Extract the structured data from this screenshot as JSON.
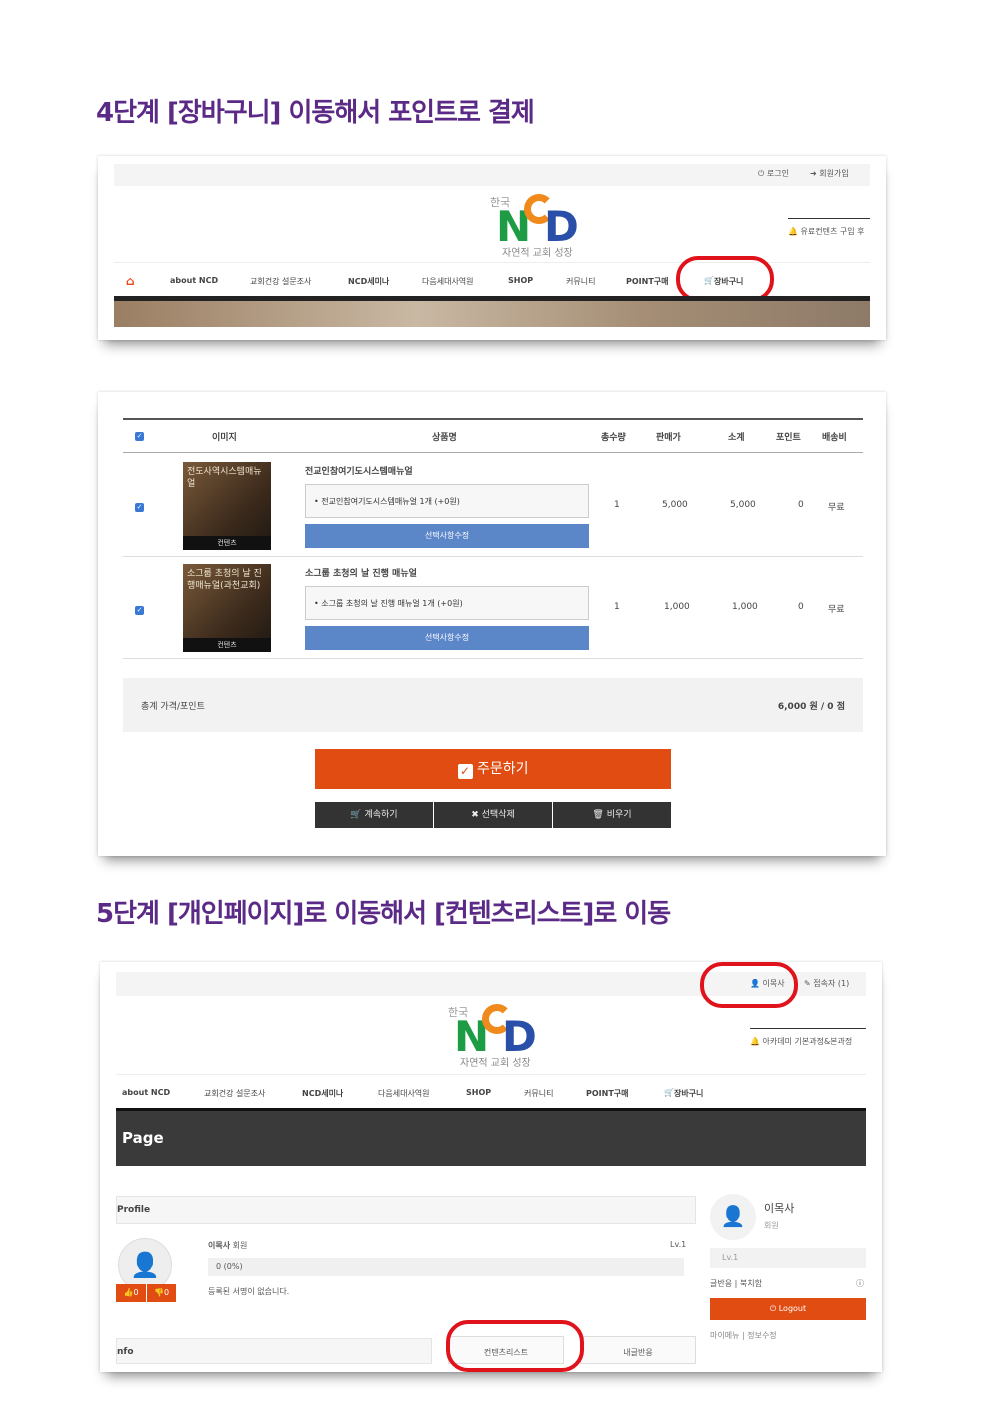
{
  "step4": {
    "title": "4단계 [장바구니] 이동해서 포인트로 결제",
    "topbar": {
      "login": "로그인",
      "join": "회원가입"
    },
    "logo": {
      "kr": "한국",
      "n": "N",
      "d": "D",
      "sub": "자연적 교회 성장"
    },
    "paid_label": "유료컨텐츠 구입 후",
    "nav": [
      "about NCD",
      "교회건강 설문조사",
      "NCD세미나",
      "다음세대사역원",
      "SHOP",
      "커뮤니티",
      "POINT구매",
      "장바구니"
    ]
  },
  "cart": {
    "headers": [
      "이미지",
      "상품명",
      "총수량",
      "판매가",
      "소계",
      "포인트",
      "배송비"
    ],
    "items": [
      {
        "img_caption": "전도사역시스템매뉴얼",
        "img_tag": "컨텐츠",
        "name": "전교인참여기도시스템매뉴얼",
        "option": "전교인참여기도시스템매뉴얼 1개 (+0원)",
        "edit": "선택사항수정",
        "qty": "1",
        "price": "5,000",
        "subtotal": "5,000",
        "point": "0",
        "ship": "무료"
      },
      {
        "img_caption": "소그룹 초청의 날 진행매뉴얼(과천교회)",
        "img_tag": "컨텐츠",
        "name": "소그룹 초청의 날 진행 매뉴얼",
        "option": "소그룹 초청의 날 진행 매뉴얼 1개 (+0원)",
        "edit": "선택사항수정",
        "qty": "1",
        "price": "1,000",
        "subtotal": "1,000",
        "point": "0",
        "ship": "무료"
      }
    ],
    "total_label": "총계 가격/포인트",
    "total_value": "6,000 원 / 0 점",
    "order_btn": "주문하기",
    "continue_btn": "계속하기",
    "delete_btn": "선택삭제",
    "empty_btn": "비우기"
  },
  "step5": {
    "title": "5단계 [개인페이지]로 이동해서 [컨텐츠리스트]로 이동",
    "user_link": "이목사",
    "access_link": "접속자 (1)",
    "academy": "아카데미 기본과정&본과정",
    "nav": [
      "about NCD",
      "교회건강 설문조사",
      "NCD세미나",
      "다음세대사역원",
      "SHOP",
      "커뮤니티",
      "POINT구매",
      "장바구니"
    ],
    "page_heading": "Page",
    "profile_label": "Profile",
    "info_label": "nfo",
    "user_name": "이목사",
    "user_role": "회원",
    "level": "Lv.1",
    "progress": "0 (0%)",
    "no_sign": "등록된 서명이 없습니다.",
    "likes": "0",
    "dislikes": "0",
    "side_name": "이목사",
    "side_role": "회원",
    "side_level": "Lv.1",
    "side_links": "글반응  |  북치함",
    "logout": "Logout",
    "side_bottom": "마이메뉴  |  정보수정",
    "tab_contents": "컨텐츠리스트",
    "tab_reply": "내글반응"
  }
}
